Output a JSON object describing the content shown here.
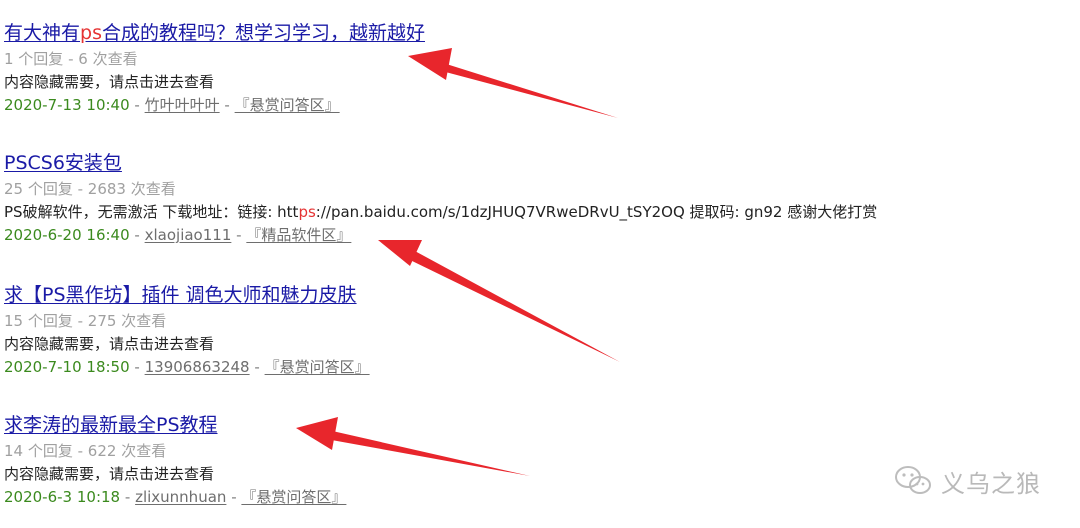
{
  "colors": {
    "link": "#1a1aa6",
    "highlight": "#e53333",
    "stats": "#a0a0a0",
    "date": "#3b8a1e",
    "arrow": "#e8262c"
  },
  "results": [
    {
      "title_before": "有大神有",
      "title_hl": "ps",
      "title_after": "合成的教程吗？想学习学习，越新越好",
      "stats": "1 个回复 - 6 次查看",
      "summary_before": "内容隐藏需要，请点击进去查看",
      "summary_hl": "",
      "summary_after": "",
      "date": "2020-7-13 10:40",
      "separator": "-",
      "author": "竹叶叶叶叶",
      "forum": "『悬赏问答区』"
    },
    {
      "title_before": "PSCS6安装包",
      "title_hl": "",
      "title_after": "",
      "stats": "25 个回复 - 2683 次查看",
      "summary_before": "PS破解软件，无需激活 下载地址：链接: htt",
      "summary_hl": "ps",
      "summary_after": "://pan.baidu.com/s/1dzJHUQ7VRweDRvU_tSY2OQ 提取码: gn92 感谢大佬打赏",
      "date": "2020-6-20 16:40",
      "separator": "-",
      "author": "xlaojiao111",
      "forum": "『精品软件区』"
    },
    {
      "title_before": "求【PS黑作坊】插件 调色大师和魅力皮肤",
      "title_hl": "",
      "title_after": "",
      "stats": "15 个回复 - 275 次查看",
      "summary_before": "内容隐藏需要，请点击进去查看",
      "summary_hl": "",
      "summary_after": "",
      "date": "2020-7-10 18:50",
      "separator": "-",
      "author": "13906863248",
      "forum": "『悬赏问答区』"
    },
    {
      "title_before": "求李涛的最新最全PS教程",
      "title_hl": "",
      "title_after": "",
      "stats": "14 个回复 - 622 次查看",
      "summary_before": "内容隐藏需要，请点击进去查看",
      "summary_hl": "",
      "summary_after": "",
      "date": "2020-6-3 10:18",
      "separator": "-",
      "author": "zlixunnhuan",
      "forum": "『悬赏问答区』"
    }
  ],
  "watermark": {
    "icon": "wechat-icon",
    "text": "义乌之狼"
  }
}
